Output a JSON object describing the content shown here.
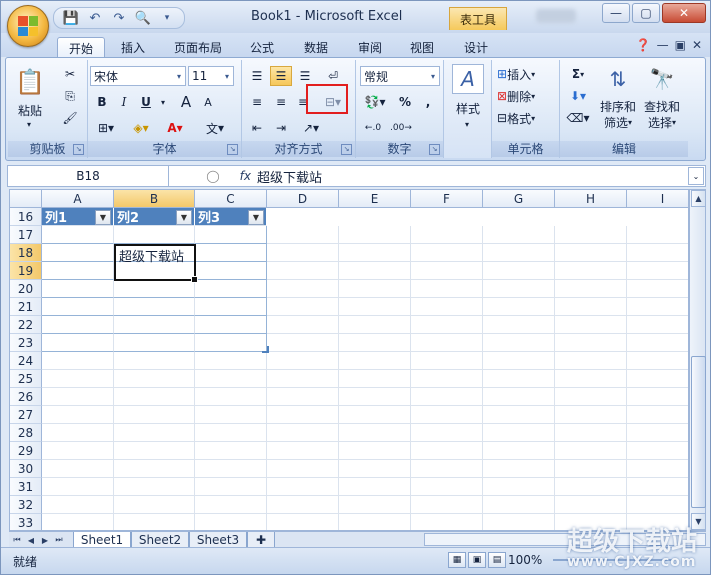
{
  "window": {
    "title": "Book1 - Microsoft Excel",
    "context_tab": "表工具"
  },
  "tabs": [
    "开始",
    "插入",
    "页面布局",
    "公式",
    "数据",
    "审阅",
    "视图",
    "设计"
  ],
  "clipboard": {
    "paste": "粘贴",
    "group": "剪贴板"
  },
  "font": {
    "name": "宋体",
    "size": "11",
    "bold": "B",
    "italic": "I",
    "underline": "U",
    "grow": "A",
    "shrink": "A",
    "phonetic": "文",
    "group": "字体"
  },
  "alignment": {
    "group": "对齐方式"
  },
  "number": {
    "format": "常规",
    "percent": "%",
    "comma": ",",
    "group": "数字"
  },
  "styles": {
    "label": "样式"
  },
  "cells": {
    "insert": "插入",
    "delete": "删除",
    "format": "格式",
    "group": "单元格"
  },
  "editing": {
    "sum": "Σ",
    "sort": "排序和",
    "sort2": "筛选",
    "find": "查找和",
    "find2": "选择",
    "group": "编辑"
  },
  "formula_bar": {
    "name_box": "B18",
    "fx": "fx",
    "content": "超级下载站"
  },
  "columns": [
    "A",
    "B",
    "C",
    "D",
    "E",
    "F",
    "G",
    "H",
    "I"
  ],
  "rows": [
    "16",
    "17",
    "18",
    "19",
    "20",
    "21",
    "22",
    "23",
    "24",
    "25",
    "26",
    "27",
    "28",
    "29",
    "30",
    "31",
    "32",
    "33"
  ],
  "table": {
    "headers": [
      "列1",
      "列2",
      "列3"
    ],
    "b18": "超级下载站"
  },
  "sheets": [
    "Sheet1",
    "Sheet2",
    "Sheet3"
  ],
  "status": {
    "ready": "就绪",
    "zoom": "100%"
  },
  "watermark": {
    "text": "超级下载站",
    "url": "www.CJXZ.com"
  }
}
